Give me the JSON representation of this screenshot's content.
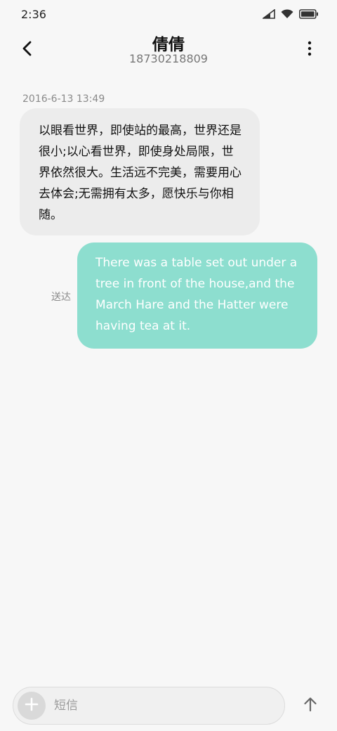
{
  "status_bar": {
    "time": "2:36",
    "icons": [
      "signal-icon",
      "wifi-icon",
      "battery-icon"
    ]
  },
  "header": {
    "contact_name": "倩倩",
    "contact_number": "18730218809",
    "icons": [
      "back-arrow-icon",
      "more-vertical-icon"
    ]
  },
  "conversation": {
    "date": "2016-6-13 13:49",
    "received_message": "以眼看世界，即使站的最高，世界还是很小;以心看世界，即使身处局限，世界依然很大。生活远不完美，需要用心去体会;无需拥有太多，愿快乐与你相随。",
    "sent_message": "There was a table set out under a tree in front of the house,and the March Hare and the Hatter were having tea at it.",
    "sent_status": "送达"
  },
  "composer": {
    "placeholder": "短信",
    "icons": [
      "plus-icon",
      "send-arrow-icon"
    ]
  },
  "colors": {
    "background": "#f7f7f7",
    "received_bubble": "#ececec",
    "sent_bubble": "#8ddecf",
    "sent_text": "#ffffff"
  }
}
